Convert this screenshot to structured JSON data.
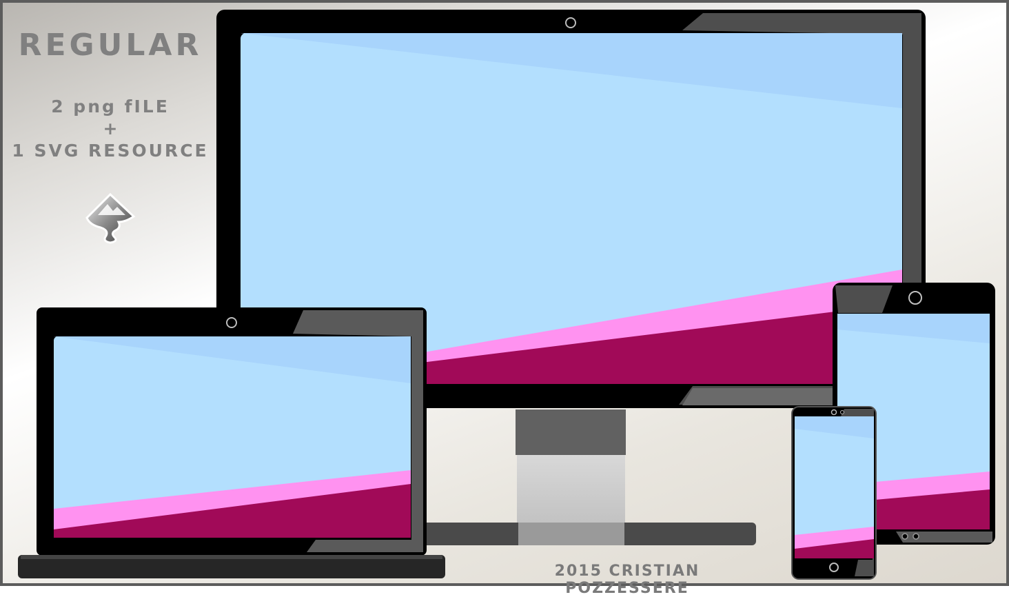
{
  "promo": {
    "title": "REGULAR",
    "line1": "2 png fILE",
    "plus": "+",
    "line2": "1 SVG RESOURCE"
  },
  "credit": "2015 CRISTIAN POZZESSERE",
  "icons": {
    "logo": "inkscape-icon"
  },
  "colors": {
    "screen_blue": "#b3dffe",
    "pink": "#ff92f0",
    "magenta": "#a10a58",
    "bezel": "#000000",
    "gray": "#555555"
  }
}
